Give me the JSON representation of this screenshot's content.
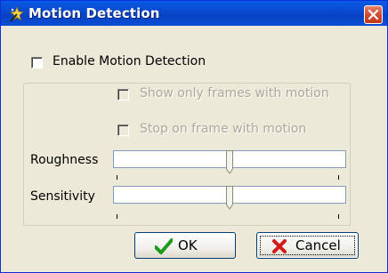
{
  "window": {
    "title": "Motion Detection"
  },
  "enable_motion": {
    "label": "Enable Motion Detection",
    "checked": false
  },
  "options": {
    "show_only_frames": {
      "label": "Show only frames with motion",
      "checked": false,
      "enabled": false
    },
    "stop_on_frame": {
      "label": "Stop on frame with motion",
      "checked": false,
      "enabled": false
    }
  },
  "sliders": {
    "roughness": {
      "label": "Roughness",
      "value_fraction": 0.51
    },
    "sensitivity": {
      "label": "Sensitivity",
      "value_fraction": 0.51
    }
  },
  "buttons": {
    "ok": "OK",
    "cancel": "Cancel"
  },
  "icons": {
    "app": "wand-star-icon",
    "close": "close-x-icon",
    "ok": "green-check-icon",
    "cancel": "red-x-icon"
  },
  "colors": {
    "titlebar": "#0842c4",
    "close_button": "#d3482a",
    "dialog_bg": "#ece9d8",
    "disabled_text": "#aca899"
  }
}
